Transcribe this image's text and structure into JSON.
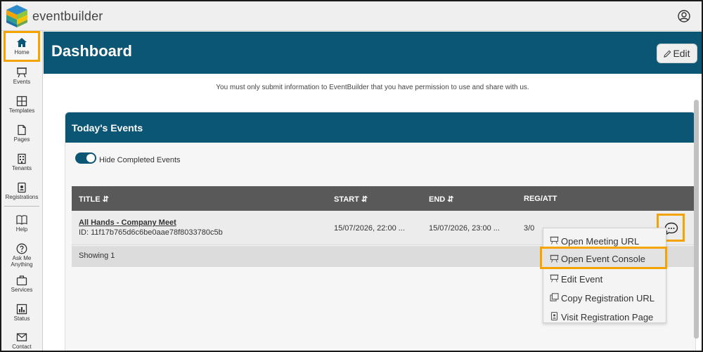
{
  "app": {
    "brand": "eventbuilder"
  },
  "sidebar": {
    "items": [
      {
        "label": "Home",
        "icon": "home-icon"
      },
      {
        "label": "Events",
        "icon": "easel-icon"
      },
      {
        "label": "Templates",
        "icon": "layout-icon"
      },
      {
        "label": "Pages",
        "icon": "page-icon"
      },
      {
        "label": "Tenants",
        "icon": "building-icon"
      },
      {
        "label": "Registrations",
        "icon": "badge-icon"
      },
      {
        "label": "Help",
        "icon": "book-icon"
      },
      {
        "label": "Ask Me",
        "label2": "Anything",
        "icon": "question-icon"
      },
      {
        "label": "Services",
        "icon": "briefcase-icon"
      },
      {
        "label": "Status",
        "icon": "chart-icon"
      },
      {
        "label": "Contact",
        "icon": "mail-icon"
      }
    ]
  },
  "header": {
    "title": "Dashboard",
    "edit_label": "Edit"
  },
  "notice": "You must only submit information to EventBuilder that you have permission to use and share with us.",
  "card": {
    "title": "Today's Events",
    "toggle_label": "Hide Completed Events",
    "toggle_on": true,
    "columns": {
      "title": "TITLE ⇵",
      "start": "START ⇵",
      "end": "END ⇵",
      "regatt": "REG/ATT"
    },
    "rows": [
      {
        "name": "All Hands - Company Meet",
        "id": "ID: 11f17b765d6c6be0aae78f8033780c5b",
        "start": "15/07/2026, 22:00 ...",
        "end": "15/07/2026, 23:00 ...",
        "regatt": "3/0"
      }
    ],
    "showing": "Showing 1"
  },
  "menu": {
    "items": [
      {
        "label": "Open Meeting URL",
        "icon": "easel-icon"
      },
      {
        "label": "Open Event Console",
        "icon": "easel-icon",
        "highlighted": true
      },
      {
        "label": "Edit Event",
        "icon": "easel-icon"
      },
      {
        "label": "Copy Registration URL",
        "icon": "copy-icon"
      },
      {
        "label": "Visit Registration Page",
        "icon": "badge-icon"
      }
    ]
  },
  "colors": {
    "primary": "#0b5575",
    "highlight": "#f5a300"
  }
}
